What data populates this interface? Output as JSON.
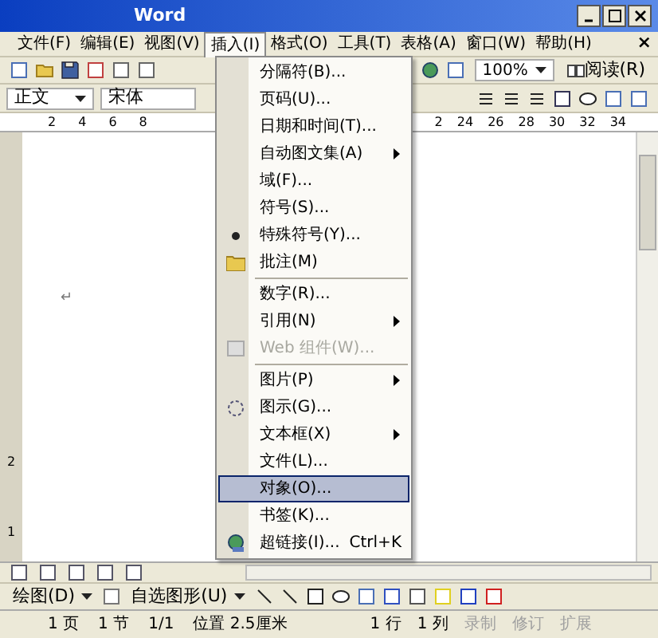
{
  "window": {
    "title": "Word"
  },
  "menubar": [
    {
      "label": "文件(F)",
      "selected": false
    },
    {
      "label": "编辑(E)",
      "selected": false
    },
    {
      "label": "视图(V)",
      "selected": false
    },
    {
      "label": "插入(I)",
      "selected": true
    },
    {
      "label": "格式(O)",
      "selected": false
    },
    {
      "label": "工具(T)",
      "selected": false
    },
    {
      "label": "表格(A)",
      "selected": false
    },
    {
      "label": "窗口(W)",
      "selected": false
    },
    {
      "label": "帮助(H)",
      "selected": false
    }
  ],
  "menubar_close": "×",
  "standard_toolbar": {
    "zoom": "100%",
    "read_button": "阅读(R)"
  },
  "format_toolbar": {
    "style": "正文",
    "font": "宋体"
  },
  "ruler": {
    "left_ticks": [
      "2",
      "4",
      "6",
      "8"
    ],
    "right_ticks": [
      "2",
      "24",
      "26",
      "28",
      "30",
      "32",
      "34"
    ]
  },
  "vertical_ruler": {
    "ticks": [
      "2",
      "1"
    ]
  },
  "document": {
    "paragraph_mark": "↵"
  },
  "insert_menu": [
    {
      "kind": "item",
      "label": "分隔符(B)...",
      "submenu": false,
      "disabled": false,
      "selected": false
    },
    {
      "kind": "item",
      "label": "页码(U)...",
      "submenu": false,
      "disabled": false,
      "selected": false
    },
    {
      "kind": "item",
      "label": "日期和时间(T)...",
      "submenu": false,
      "disabled": false,
      "selected": false
    },
    {
      "kind": "item",
      "label": "自动图文集(A)",
      "submenu": true,
      "disabled": false,
      "selected": false
    },
    {
      "kind": "item",
      "label": "域(F)...",
      "submenu": false,
      "disabled": false,
      "selected": false
    },
    {
      "kind": "item",
      "label": "符号(S)...",
      "submenu": false,
      "disabled": false,
      "selected": false
    },
    {
      "kind": "item",
      "label": "特殊符号(Y)...",
      "submenu": false,
      "disabled": false,
      "selected": false
    },
    {
      "kind": "item",
      "label": "批注(M)",
      "submenu": false,
      "disabled": false,
      "selected": false
    },
    {
      "kind": "separator"
    },
    {
      "kind": "item",
      "label": "数字(R)...",
      "submenu": false,
      "disabled": false,
      "selected": false
    },
    {
      "kind": "item",
      "label": "引用(N)",
      "submenu": true,
      "disabled": false,
      "selected": false
    },
    {
      "kind": "item",
      "label": "Web 组件(W)...",
      "submenu": false,
      "disabled": true,
      "selected": false
    },
    {
      "kind": "separator"
    },
    {
      "kind": "item",
      "label": "图片(P)",
      "submenu": true,
      "disabled": false,
      "selected": false
    },
    {
      "kind": "item",
      "label": "图示(G)...",
      "submenu": false,
      "disabled": false,
      "selected": false
    },
    {
      "kind": "item",
      "label": "文本框(X)",
      "submenu": true,
      "disabled": false,
      "selected": false
    },
    {
      "kind": "item",
      "label": "文件(L)...",
      "submenu": false,
      "disabled": false,
      "selected": false
    },
    {
      "kind": "item",
      "label": "对象(O)...",
      "submenu": false,
      "disabled": false,
      "selected": true
    },
    {
      "kind": "item",
      "label": "书签(K)...",
      "submenu": false,
      "disabled": false,
      "selected": false
    },
    {
      "kind": "item",
      "label": "超链接(I)...",
      "shortcut": "Ctrl+K",
      "submenu": false,
      "disabled": false,
      "selected": false
    }
  ],
  "drawing_toolbar": {
    "draw_menu": "绘图(D)",
    "autoshapes_menu": "自选图形(U)"
  },
  "status_bar": [
    {
      "text": "1 页",
      "disabled": false
    },
    {
      "text": "1 节",
      "disabled": false
    },
    {
      "text": "1/1",
      "disabled": false
    },
    {
      "text": "位置 2.5厘米",
      "disabled": false
    },
    {
      "text": "1 行",
      "disabled": false
    },
    {
      "text": "1 列",
      "disabled": false
    },
    {
      "text": "录制",
      "disabled": true
    },
    {
      "text": "修订",
      "disabled": true
    },
    {
      "text": "扩展",
      "disabled": true
    }
  ]
}
